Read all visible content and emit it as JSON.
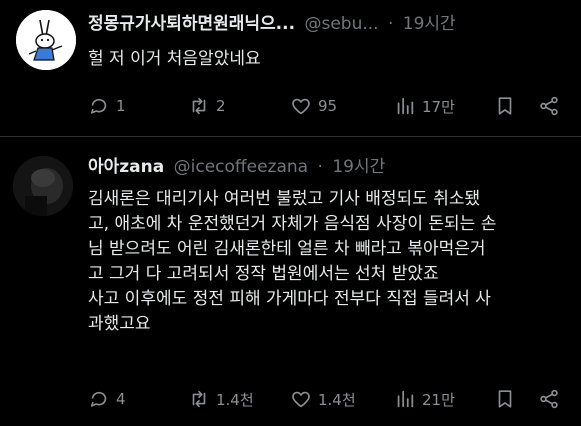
{
  "tweets": [
    {
      "display_name": "정몽규가사퇴하면원래닉으...",
      "handle": "@sebu...",
      "separator": "·",
      "time": "19시간",
      "text_lines": [
        "헐 저 이거 처음알았네요"
      ],
      "stats": {
        "replies": "1",
        "retweets": "2",
        "likes": "95",
        "views": "17만"
      }
    },
    {
      "display_name": "아아zana",
      "handle": "@icecoffeezana",
      "separator": "·",
      "time": "19시간",
      "text_lines": [
        "김새론은 대리기사 여러번 불렀고 기사 배정되도 취소됐",
        "고, 애초에 차 운전했던거 자체가 음식점 사장이 돈되는 손",
        "님 받으려도 어린 김새론한테 얼른 차 빼라고 볶아먹은거",
        "고 그거 다 고려되서 정작 법원에서는 선처 받았죠",
        "사고 이후에도 정전 피해 가게마다 전부다 직접 들려서 사",
        "과했고요"
      ],
      "stats": {
        "replies": "4",
        "retweets": "1.4천",
        "likes": "1.4천",
        "views": "21만"
      }
    }
  ],
  "icons": {
    "reply": "reply-icon",
    "retweet": "retweet-icon",
    "like": "heart-icon",
    "views": "views-chart-icon",
    "bookmark": "bookmark-icon",
    "share": "share-icon"
  },
  "colors": {
    "background": "#000000",
    "text": "#e7e9ea",
    "secondary": "#71767b",
    "icon": "#8b8f94",
    "divider": "#2f3336"
  }
}
